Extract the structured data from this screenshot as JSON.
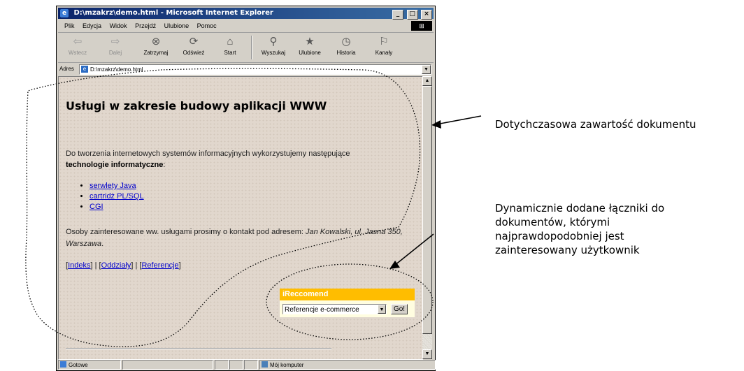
{
  "window": {
    "title": "D:\\mzakrz\\demo.html - Microsoft Internet Explorer",
    "controls": {
      "minimize": "_",
      "maximize": "□",
      "close": "×"
    }
  },
  "menu": [
    "Plik",
    "Edycja",
    "Widok",
    "Przejdź",
    "Ulubione",
    "Pomoc"
  ],
  "toolbar": [
    {
      "label": "Wstecz",
      "icon": "back-arrow-icon",
      "glyph": "⇦",
      "disabled": true
    },
    {
      "label": "Dalej",
      "icon": "forward-arrow-icon",
      "glyph": "⇨",
      "disabled": true
    },
    {
      "label": "Zatrzymaj",
      "icon": "stop-icon",
      "glyph": "⊗"
    },
    {
      "label": "Odśwież",
      "icon": "refresh-icon",
      "glyph": "⟳"
    },
    {
      "label": "Start",
      "icon": "home-icon",
      "glyph": "⌂"
    },
    {
      "label": "Wyszukaj",
      "icon": "search-icon",
      "glyph": "⚲"
    },
    {
      "label": "Ulubione",
      "icon": "favorites-icon",
      "glyph": "★"
    },
    {
      "label": "Historia",
      "icon": "history-icon",
      "glyph": "◷"
    },
    {
      "label": "Kanały",
      "icon": "channels-icon",
      "glyph": "⚐"
    }
  ],
  "address": {
    "label": "Adres",
    "value": "D:\\mzakrz\\demo.html"
  },
  "page": {
    "heading": "Usługi w zakresie budowy aplikacji WWW",
    "intro": "Do tworzenia internetowych systemów informacyjnych wykorzystujemy następujące",
    "intro_bold": "technologie informatyczne",
    "intro_end": ":",
    "links": [
      "serwlety Java",
      "cartridż PL/SQL",
      "CGI"
    ],
    "contact": "Osoby zainteresowane ww. usługami prosimy o kontakt pod adresem:",
    "contact_italic": "Jan Kowalski, ul. Jasna 350, Warszawa",
    "contact_end": ".",
    "nav": [
      "Indeks",
      "Oddziały",
      "Referencje"
    ]
  },
  "widget": {
    "title": "iReccomend",
    "select_value": "Referencje e-commerce",
    "go_label": "Go!"
  },
  "status": {
    "left": "Gotowe",
    "zone": "Mój komputer"
  },
  "callouts": {
    "top": "Dotychczasowa zawartość dokumentu",
    "bottom": "Dynamicznie dodane łączniki do dokumentów, którymi najprawdopodobniej jest zainteresowany użytkownik"
  },
  "colors": {
    "widget_header": "#ffbd00",
    "link": "#0000cc",
    "titlebar": "#0a246a"
  }
}
